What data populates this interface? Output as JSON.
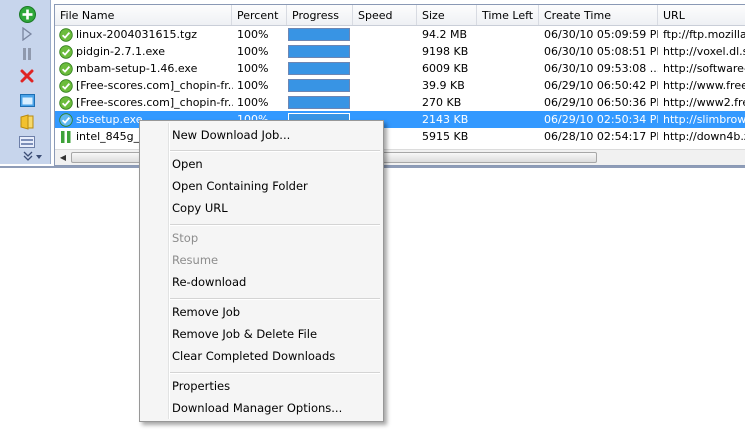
{
  "toolbar": {
    "items": [
      {
        "icon": "add-icon"
      },
      {
        "icon": "play-icon"
      },
      {
        "icon": "pause-icon"
      },
      {
        "icon": "delete-icon"
      },
      {
        "icon": "window-icon"
      },
      {
        "icon": "folder-icon"
      },
      {
        "icon": "options-icon"
      },
      {
        "icon": "expand-chevron-icon"
      }
    ]
  },
  "columns": [
    "File Name",
    "Percent",
    "Progress",
    "Speed",
    "Size",
    "Time Left",
    "Create Time",
    "URL"
  ],
  "rows": [
    {
      "status": "done",
      "name": "linux-2004031615.tgz",
      "percent": "100%",
      "progress": 1.0,
      "speed": "",
      "size": "94.2 MB",
      "time_left": "",
      "create_time": "06/30/10 05:09:59 PM",
      "url": "ftp://ftp.mozilla.o",
      "selected": false
    },
    {
      "status": "done",
      "name": "pidgin-2.7.1.exe",
      "percent": "100%",
      "progress": 1.0,
      "speed": "",
      "size": "9198 KB",
      "time_left": "",
      "create_time": "06/30/10 05:08:51 PM",
      "url": "http://voxel.dl.so",
      "selected": false
    },
    {
      "status": "done",
      "name": "mbam-setup-1.46.exe",
      "percent": "100%",
      "progress": 1.0,
      "speed": "",
      "size": "6009 KB",
      "time_left": "",
      "create_time": "06/30/10 09:53:08 ...",
      "url": "http://software-f",
      "selected": false
    },
    {
      "status": "done",
      "name": "[Free-scores.com]_chopin-fr...",
      "percent": "100%",
      "progress": 1.0,
      "speed": "",
      "size": "39.9 KB",
      "time_left": "",
      "create_time": "06/29/10 06:50:42 PM",
      "url": "http://www.free-",
      "selected": false
    },
    {
      "status": "done",
      "name": "[Free-scores.com]_chopin-fr...",
      "percent": "100%",
      "progress": 1.0,
      "speed": "",
      "size": "270 KB",
      "time_left": "",
      "create_time": "06/29/10 06:50:36 PM",
      "url": "http://www2.free",
      "selected": false
    },
    {
      "status": "done",
      "name": "sbsetup.exe",
      "percent": "100%",
      "progress": 1.0,
      "speed": "",
      "size": "2143 KB",
      "time_left": "",
      "create_time": "06/29/10 02:50:34 PM",
      "url": "http://slimbrows",
      "selected": true
    },
    {
      "status": "paused",
      "name": "intel_845g_1",
      "percent": "",
      "progress": 1.0,
      "speed": "",
      "size": "5915 KB",
      "time_left": "",
      "create_time": "06/28/10 02:54:17 PM",
      "url": "http://down4b.zo",
      "selected": false
    }
  ],
  "context_menu": {
    "new_job": "New Download Job...",
    "open": "Open",
    "open_folder": "Open Containing Folder",
    "copy_url": "Copy URL",
    "stop": "Stop",
    "resume": "Resume",
    "redownload": "Re-download",
    "remove_job": "Remove Job",
    "remove_delete": "Remove Job & Delete File",
    "clear_completed": "Clear Completed Downloads",
    "properties": "Properties",
    "options": "Download Manager Options..."
  },
  "colors": {
    "selection": "#3399ff",
    "progress": "#3894e4",
    "toolbar": "#c7d5ec"
  }
}
